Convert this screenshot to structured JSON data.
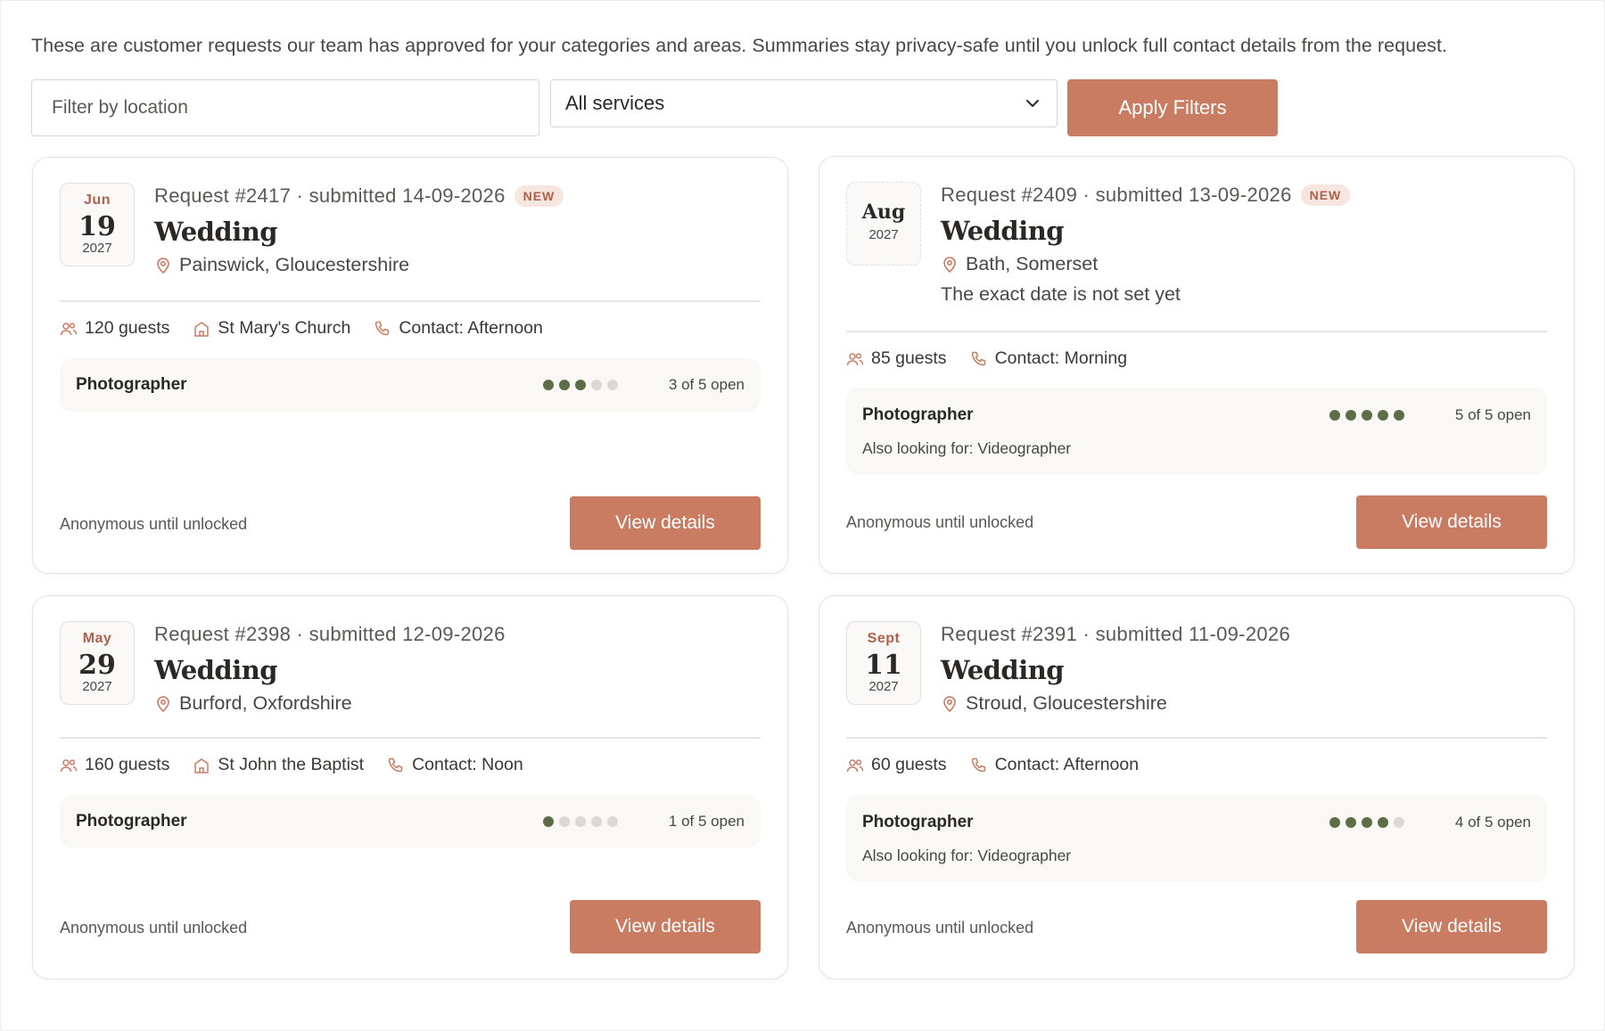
{
  "intro": "These are customer requests our team has approved for your categories and areas. Summaries stay privacy-safe until you unlock full contact details from the request.",
  "filters": {
    "location_placeholder": "Filter by location",
    "service_selected": "All services",
    "apply_label": "Apply Filters"
  },
  "colors": {
    "accent": "#c97c62",
    "dot_filled": "#5c6e47",
    "dot_empty": "#dcd8d3",
    "badge_text": "#b0604a"
  },
  "cards": [
    {
      "month": "Jun",
      "day": "19",
      "year": "2027",
      "request": "Request #2417 · submitted 14-09-2026",
      "badge": "NEW",
      "title": "Wedding",
      "location": "Painswick, Gloucestershire",
      "guests": "120 guests",
      "venue": "St Mary's Church",
      "contact": "Contact: Afternoon",
      "service": "Photographer",
      "open_count": 3,
      "open_total": 5,
      "open_label": "3 of 5 open",
      "anon": "Anonymous until unlocked",
      "button": "View details"
    },
    {
      "month": "Aug",
      "year": "2027",
      "request": "Request #2409 · submitted 13-09-2026",
      "badge": "NEW",
      "title": "Wedding",
      "location": "Bath, Somerset",
      "date_note": "The exact date is not set yet",
      "guests": "85 guests",
      "contact": "Contact: Morning",
      "service": "Photographer",
      "open_count": 5,
      "open_total": 5,
      "open_label": "5 of 5 open",
      "also": "Also looking for: Videographer",
      "anon": "Anonymous until unlocked",
      "button": "View details"
    },
    {
      "month": "May",
      "day": "29",
      "year": "2027",
      "request": "Request #2398 · submitted 12-09-2026",
      "title": "Wedding",
      "location": "Burford, Oxfordshire",
      "guests": "160 guests",
      "venue": "St John the Baptist",
      "contact": "Contact: Noon",
      "service": "Photographer",
      "open_count": 1,
      "open_total": 5,
      "open_label": "1 of 5 open",
      "anon": "Anonymous until unlocked",
      "button": "View details"
    },
    {
      "month": "Sept",
      "day": "11",
      "year": "2027",
      "request": "Request #2391 · submitted 11-09-2026",
      "title": "Wedding",
      "location": "Stroud, Gloucestershire",
      "guests": "60 guests",
      "contact": "Contact: Afternoon",
      "service": "Photographer",
      "open_count": 4,
      "open_total": 5,
      "open_label": "4 of 5 open",
      "also": "Also looking for: Videographer",
      "anon": "Anonymous until unlocked",
      "button": "View details"
    }
  ]
}
